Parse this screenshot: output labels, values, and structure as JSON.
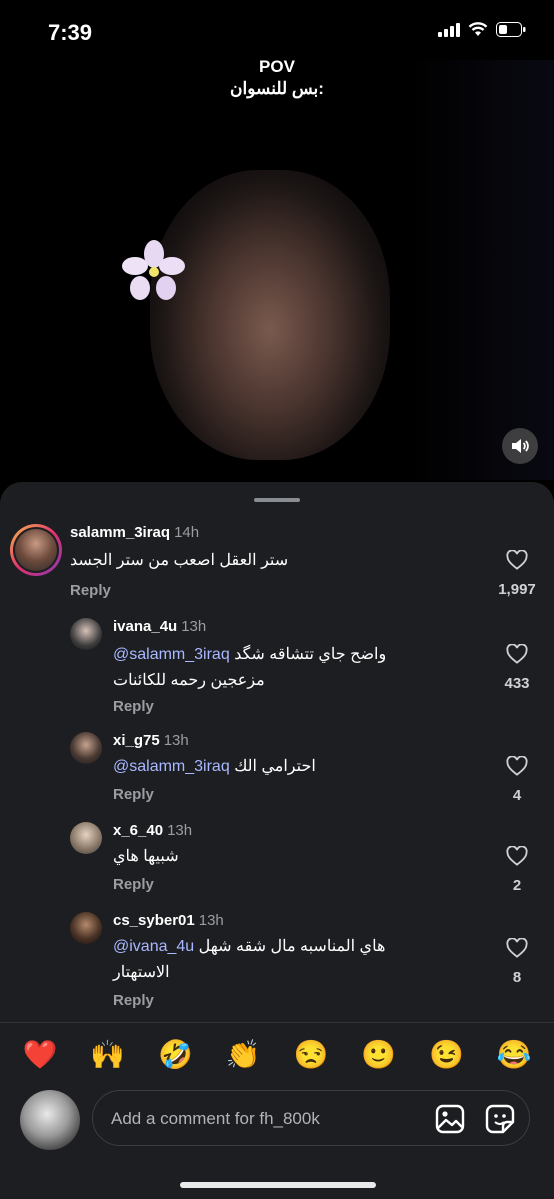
{
  "status": {
    "time": "7:39"
  },
  "video": {
    "overlay_line1": "POV",
    "overlay_line2": "بس للنسوان:"
  },
  "comments": [
    {
      "username": "salamm_3iraq",
      "time": "14h",
      "text": "ستر العقل اصعب من ستر الجسد",
      "mention": "",
      "reply": "Reply",
      "likes": "1,997"
    },
    {
      "username": "ivana_4u",
      "time": "13h",
      "mention": "@salamm_3iraq",
      "text": "واضح جاي تتشاقه شگد",
      "text2": "مزعجين رحمه للكائنات",
      "reply": "Reply",
      "likes": "433"
    },
    {
      "username": "xi_g75",
      "time": "13h",
      "mention": "@salamm_3iraq",
      "text": "احترامي الك",
      "reply": "Reply",
      "likes": "4"
    },
    {
      "username": "x_6_40",
      "time": "13h",
      "mention": "",
      "text": "شبيها هاي",
      "reply": "Reply",
      "likes": "2"
    },
    {
      "username": "cs_syber01",
      "time": "13h",
      "mention": "@ivana_4u",
      "text": "هاي المناسبه مال شقه شهل",
      "text2": "الاستهتار",
      "reply": "Reply",
      "likes": "8"
    }
  ],
  "reactions": [
    "❤️",
    "🙌",
    "🤣",
    "👏",
    "😒",
    "🙂",
    "😉",
    "😂"
  ],
  "composer": {
    "placeholder": "Add a comment for fh_800k"
  }
}
